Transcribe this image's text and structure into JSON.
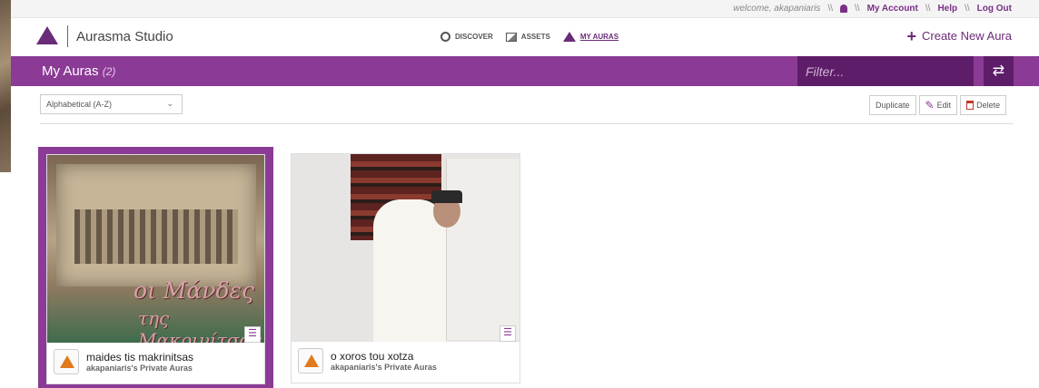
{
  "topbar": {
    "welcome": "welcome, akapaniaris",
    "sep": "\\\\",
    "my_account": "My Account",
    "help": "Help",
    "logout": "Log Out"
  },
  "header": {
    "brand": "Aurasma Studio",
    "nav": [
      {
        "label": "DISCOVER",
        "icon": "discover-icon"
      },
      {
        "label": "ASSETS",
        "icon": "image-icon"
      },
      {
        "label": "MY AURAS",
        "icon": "aura-icon",
        "active": true
      }
    ],
    "create_label": "Create New Aura"
  },
  "bar": {
    "title": "My Auras",
    "count": "(2)",
    "filter_placeholder": "Filter...",
    "refresh_glyph": "⇄"
  },
  "toolbar": {
    "sort_value": "Alphabetical (A-Z)",
    "duplicate": "Duplicate",
    "edit": "Edit",
    "delete": "Delete"
  },
  "cards": [
    {
      "name": "maides tis makrinitsas",
      "owner": "akapaniaris's Private Auras",
      "selected": true,
      "overlay1": "οι Μάνδες",
      "overlay2": "της Μακρινίτσας"
    },
    {
      "name": "o xoros tou xotza",
      "owner": "akapaniaris's Private Auras",
      "selected": false
    }
  ],
  "colors": {
    "accent": "#8b3b96",
    "accent_dark": "#5e1d69",
    "brand": "#6a2b78"
  }
}
